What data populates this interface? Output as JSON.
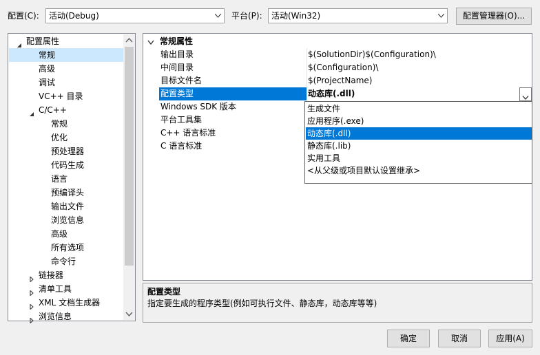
{
  "top": {
    "config_label": "配置(C):",
    "config_value": "活动(Debug)",
    "platform_label": "平台(P):",
    "platform_value": "活动(Win32)",
    "config_manager": "配置管理器(O)..."
  },
  "tree": [
    {
      "label": "配置属性",
      "level": 0,
      "expander": "expanded"
    },
    {
      "label": "常规",
      "level": 1,
      "selected": true
    },
    {
      "label": "高级",
      "level": 1
    },
    {
      "label": "调试",
      "level": 1
    },
    {
      "label": "VC++ 目录",
      "level": 1
    },
    {
      "label": "C/C++",
      "level": 1,
      "expander": "expanded"
    },
    {
      "label": "常规",
      "level": 2
    },
    {
      "label": "优化",
      "level": 2
    },
    {
      "label": "预处理器",
      "level": 2
    },
    {
      "label": "代码生成",
      "level": 2
    },
    {
      "label": "语言",
      "level": 2
    },
    {
      "label": "预编译头",
      "level": 2
    },
    {
      "label": "输出文件",
      "level": 2
    },
    {
      "label": "浏览信息",
      "level": 2
    },
    {
      "label": "高级",
      "level": 2
    },
    {
      "label": "所有选项",
      "level": 2
    },
    {
      "label": "命令行",
      "level": 2
    },
    {
      "label": "链接器",
      "level": 1,
      "expander": "collapsed"
    },
    {
      "label": "清单工具",
      "level": 1,
      "expander": "collapsed"
    },
    {
      "label": "XML 文档生成器",
      "level": 1,
      "expander": "collapsed"
    },
    {
      "label": "浏览信息",
      "level": 1,
      "expander": "collapsed"
    }
  ],
  "grid": {
    "section": "常规属性",
    "rows": [
      {
        "key": "输出目录",
        "value": "$(SolutionDir)$(Configuration)\\"
      },
      {
        "key": "中间目录",
        "value": "$(Configuration)\\"
      },
      {
        "key": "目标文件名",
        "value": "$(ProjectName)"
      },
      {
        "key": "配置类型",
        "value": "动态库(.dll)",
        "selected": true
      },
      {
        "key": "Windows SDK 版本",
        "value": ""
      },
      {
        "key": "平台工具集",
        "value": ""
      },
      {
        "key": "C++ 语言标准",
        "value": ""
      },
      {
        "key": "C 语言标准",
        "value": ""
      }
    ],
    "dropdown_options": [
      "生成文件",
      "应用程序(.exe)",
      "动态库(.dll)",
      "静态库(.lib)",
      "实用工具",
      "<从父级或项目默认设置继承>"
    ],
    "dropdown_selected_index": 2
  },
  "description": {
    "title": "配置类型",
    "text": "指定要生成的程序类型(例如可执行文件、静态库，动态库等等)"
  },
  "buttons": {
    "ok": "确定",
    "cancel": "取消",
    "apply": "应用(A)"
  },
  "colors": {
    "selection": "#0078d7",
    "tree_selection": "#cce8ff",
    "border": "#828790"
  }
}
